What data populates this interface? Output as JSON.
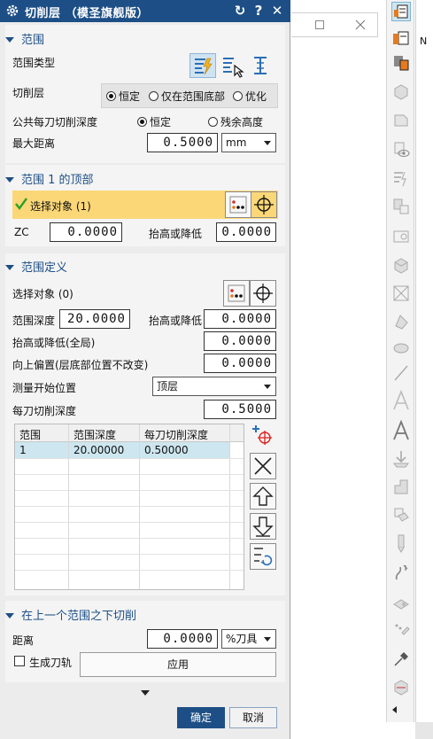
{
  "dialog": {
    "title": "切削层 （模圣旗舰版）",
    "btn_reset": "↻",
    "btn_help": "?",
    "btn_close": "✕"
  },
  "range": {
    "header": "范围",
    "type_label": "范围类型",
    "layer_label": "切削层",
    "layer_options": [
      "恒定",
      "仅在范围底部",
      "优化"
    ],
    "layer_selected": "恒定",
    "common_depth_label": "公共每刀切削深度",
    "depth_options": [
      "恒定",
      "残余高度"
    ],
    "depth_selected": "恒定",
    "max_dist_label": "最大距离",
    "max_dist_value": "0.5000",
    "unit": "mm"
  },
  "top": {
    "header": "范围 1 的顶部",
    "select_label": "选择对象 (1)",
    "zc_label": "ZC",
    "zc_value": "0.0000",
    "raise_label": "抬高或降低",
    "raise_value": "0.0000"
  },
  "def": {
    "header": "范围定义",
    "select_label": "选择对象 (0)",
    "depth_label": "范围深度",
    "depth_value": "20.0000",
    "raise_label": "抬高或降低",
    "raise_value": "0.0000",
    "raise_all_label": "抬高或降低(全局)",
    "raise_all_value": "0.0000",
    "offset_label": "向上偏置(层底部位置不改变)",
    "offset_value": "0.0000",
    "measure_label": "测量开始位置",
    "measure_value": "顶层",
    "cut_depth_label": "每刀切削深度",
    "cut_depth_value": "0.5000",
    "table": {
      "headers": [
        "范围",
        "范围深度",
        "每刀切削深度"
      ],
      "rows": [
        [
          "1",
          "20.00000",
          "0.50000"
        ]
      ]
    }
  },
  "below": {
    "header": "在上一个范围之下切削",
    "dist_label": "距离",
    "dist_value": "0.0000",
    "unit": "%刀具",
    "gen_label": "生成刀轨",
    "apply_label": "应用"
  },
  "footer": {
    "ok": "确定",
    "cancel": "取消"
  },
  "bgapp": {
    "letter": "N"
  },
  "colors": {
    "title_bar": "#1d4f86",
    "section_header": "#1d4f86",
    "selected_highlight": "#fbd777",
    "check": "#2aa12a",
    "ok_button": "#1d4f86"
  }
}
